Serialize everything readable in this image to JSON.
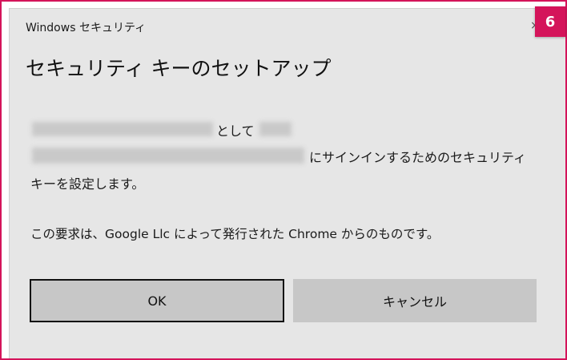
{
  "dialog": {
    "app_name": "Windows セキュリティ",
    "title": "セキュリティ キーのセットアップ",
    "line1_suffix": "として",
    "line2_suffix": "にサインインするためのセキュリティ",
    "line3": "キーを設定します。",
    "request_info": "この要求は、Google Llc によって発行された Chrome からのものです。",
    "ok_label": "OK",
    "cancel_label": "キャンセル",
    "close_glyph": "×"
  },
  "badge": {
    "step_number": "6",
    "color": "#d4145a"
  }
}
